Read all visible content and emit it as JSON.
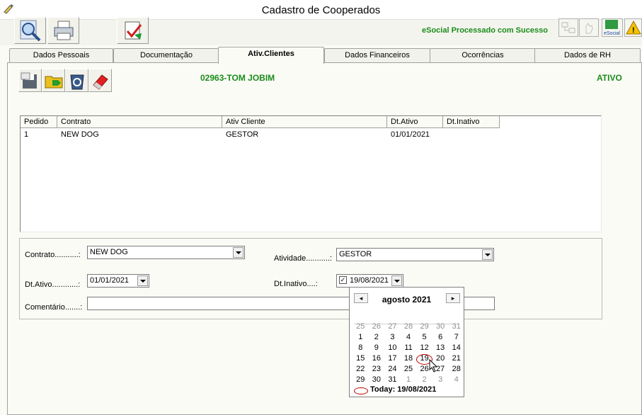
{
  "window": {
    "title": "Cadastro de Cooperados"
  },
  "status": {
    "esocial": "eSocial Processado com Sucesso",
    "esocial_badge": "eSocial"
  },
  "tabs": [
    {
      "label": "Dados Pessoais"
    },
    {
      "label": "Documentação"
    },
    {
      "label": "Ativ.Clientes"
    },
    {
      "label": "Dados Financeiros"
    },
    {
      "label": "Ocorrências"
    },
    {
      "label": "Dados de RH"
    }
  ],
  "cooperado": {
    "name": "02963-TOM JOBIM",
    "status": "ATIVO"
  },
  "grid": {
    "columns": [
      "Pedido",
      "Contrato",
      "Ativ Cliente",
      "Dt.Ativo",
      "Dt.Inativo"
    ],
    "rows": [
      [
        "1",
        "NEW DOG",
        "GESTOR",
        "01/01/2021",
        ""
      ]
    ]
  },
  "form": {
    "contrato_label": "Contrato...........:",
    "contrato_value": "NEW DOG",
    "atividade_label": "Atividade...........:",
    "atividade_value": "GESTOR",
    "dtativo_label": "Dt.Ativo............:",
    "dtativo_value": "01/01/2021",
    "dtinativo_label": "Dt.Inativo....:",
    "dtinativo_value": "19/08/2021",
    "comentario_label": "Comentário.......:"
  },
  "calendar": {
    "month": "agosto 2021",
    "prev": "◂",
    "next": "▸",
    "weeks": [
      [
        "25",
        "26",
        "27",
        "28",
        "29",
        "30",
        "31"
      ],
      [
        "1",
        "2",
        "3",
        "4",
        "5",
        "6",
        "7"
      ],
      [
        "8",
        "9",
        "10",
        "11",
        "12",
        "13",
        "14"
      ],
      [
        "15",
        "16",
        "17",
        "18",
        "19",
        "20",
        "21"
      ],
      [
        "22",
        "23",
        "24",
        "25",
        "26",
        "27",
        "28"
      ],
      [
        "29",
        "30",
        "31",
        "1",
        "2",
        "3",
        "4"
      ]
    ],
    "today": "Today: 19/08/2021"
  },
  "colors": {
    "green_text": "#1a8c1a",
    "selection_ring": "#c00000"
  }
}
